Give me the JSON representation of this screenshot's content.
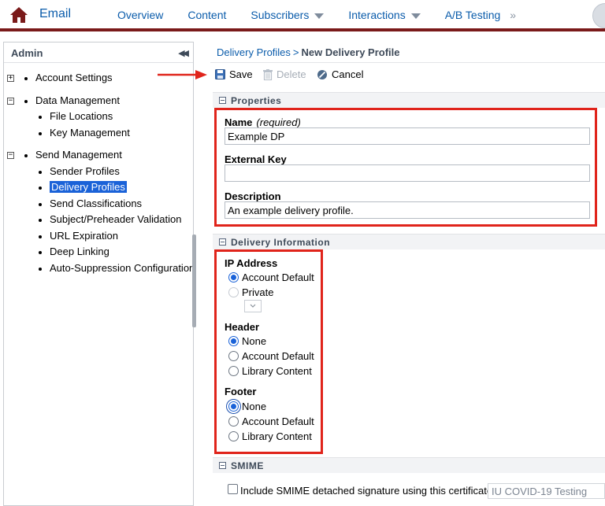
{
  "topnav": {
    "app_name": "Email",
    "items": [
      {
        "label": "Overview",
        "dropdown": false
      },
      {
        "label": "Content",
        "dropdown": false
      },
      {
        "label": "Subscribers",
        "dropdown": true
      },
      {
        "label": "Interactions",
        "dropdown": true
      },
      {
        "label": "A/B Testing",
        "dropdown": false
      }
    ],
    "more_glyph": "»",
    "brand_color": "#7a1a1a",
    "link_color": "#0b5cab"
  },
  "sidebar": {
    "title": "Admin",
    "collapse_glyph": "◀◀",
    "tree": [
      {
        "label": "Account Settings",
        "expander": "+",
        "level": 0
      },
      {
        "label": "Data Management",
        "expander": "−",
        "level": 0
      },
      {
        "label": "File Locations",
        "level": 1
      },
      {
        "label": "Key Management",
        "level": 1
      },
      {
        "label": "Send Management",
        "expander": "−",
        "level": 0
      },
      {
        "label": "Sender Profiles",
        "level": 1
      },
      {
        "label": "Delivery Profiles",
        "level": 1,
        "selected": true
      },
      {
        "label": "Send Classifications",
        "level": 1
      },
      {
        "label": "Subject/Preheader Validation",
        "level": 1
      },
      {
        "label": "URL Expiration",
        "level": 1
      },
      {
        "label": "Deep Linking",
        "level": 1
      },
      {
        "label": "Auto-Suppression Configuration",
        "level": 1
      }
    ]
  },
  "breadcrumb": {
    "link": "Delivery Profiles",
    "separator": ">",
    "current": "New Delivery Profile"
  },
  "toolbar": {
    "save_label": "Save",
    "delete_label": "Delete",
    "cancel_label": "Cancel"
  },
  "properties": {
    "section_title": "Properties",
    "name_label": "Name",
    "name_required": "(required)",
    "name_value": "Example DP",
    "external_key_label": "External Key",
    "external_key_value": "",
    "description_label": "Description",
    "description_value": "An example delivery profile."
  },
  "delivery": {
    "section_title": "Delivery Information",
    "ip_label": "IP Address",
    "ip_options": [
      {
        "label": "Account Default",
        "checked": true
      },
      {
        "label": "Private",
        "checked": false,
        "disabled": true
      }
    ],
    "header_label": "Header",
    "header_options": [
      {
        "label": "None",
        "checked": true
      },
      {
        "label": "Account Default",
        "checked": false
      },
      {
        "label": "Library Content",
        "checked": false
      }
    ],
    "footer_label": "Footer",
    "footer_options": [
      {
        "label": "None",
        "checked": true
      },
      {
        "label": "Account Default",
        "checked": false
      },
      {
        "label": "Library Content",
        "checked": false
      }
    ]
  },
  "smime": {
    "section_title": "SMIME",
    "checkbox_label": "Include SMIME detached signature using this certificate",
    "certificate_value": "IU COVID-19 Testing"
  },
  "colors": {
    "highlight": "#e0241b",
    "selected": "#1a62d8"
  }
}
